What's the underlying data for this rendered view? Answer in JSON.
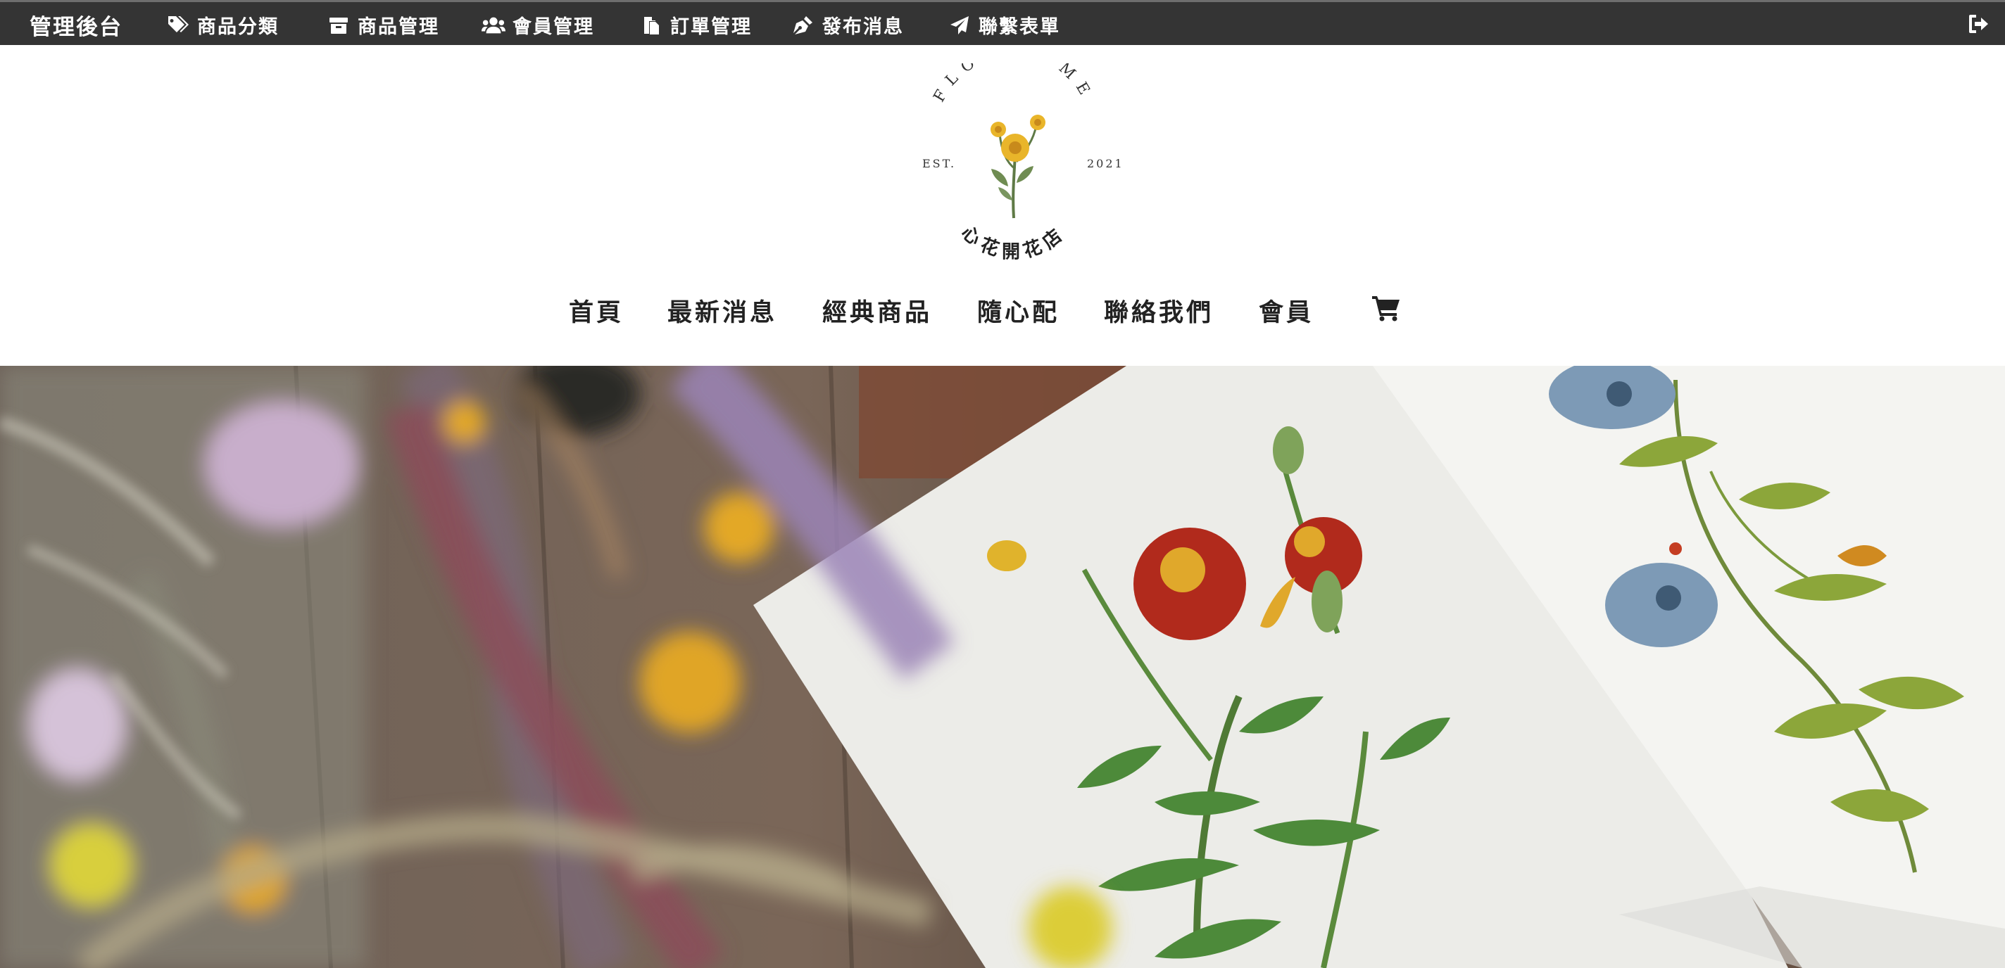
{
  "admin_bar": {
    "brand": "管理後台",
    "items": [
      {
        "label": "商品分類",
        "icon": "tags-icon"
      },
      {
        "label": "商品管理",
        "icon": "archive-box-icon"
      },
      {
        "label": "會員管理",
        "icon": "users-icon"
      },
      {
        "label": "訂單管理",
        "icon": "copy-icon"
      },
      {
        "label": "發布消息",
        "icon": "pen-nib-icon"
      },
      {
        "label": "聯繫表單",
        "icon": "paper-plane-icon"
      }
    ],
    "logout_icon": "sign-out-icon"
  },
  "logo": {
    "arc_text": "FLOWER ME",
    "est": "EST.",
    "year": "2021",
    "shop_name": "心花開花店"
  },
  "main_nav": {
    "items": [
      "首頁",
      "最新消息",
      "經典商品",
      "隨心配",
      "聯絡我們",
      "會員"
    ],
    "cart_icon": "shopping-cart-icon"
  },
  "colors": {
    "admin_bar_bg": "#343434",
    "admin_text": "#ffffff",
    "nav_text": "#222222",
    "page_bg": "#ffffff"
  }
}
